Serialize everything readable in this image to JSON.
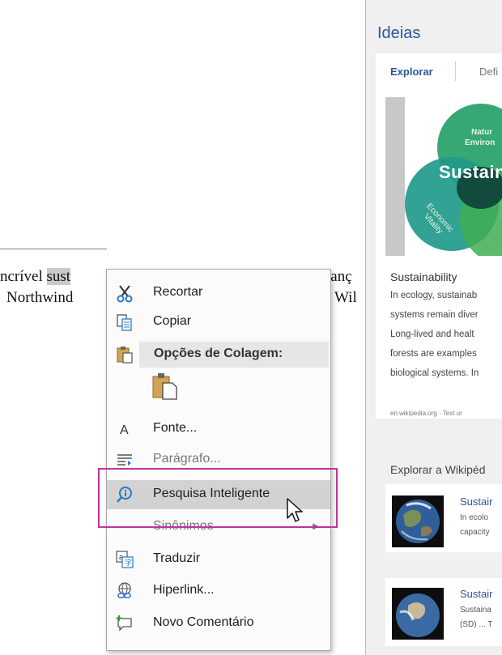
{
  "document": {
    "line1": {
      "prefix": "ncrível ",
      "highlight": "sust",
      "highlight2": "                ",
      "right": "lanç"
    },
    "line2": {
      "left": "Northwind",
      "right": "Wil"
    }
  },
  "ideas_pane": {
    "title": "Ideias",
    "tabs": [
      "Explorar",
      "Defi"
    ],
    "card": {
      "image_labels": {
        "top": "Natur",
        "top2": "Environ",
        "center": "Sustaina",
        "left": "Economic Vitality"
      },
      "heading": "Sustainability",
      "lines": [
        "In ecology, sustainab",
        "systems remain diver",
        "Long-lived and healt",
        "forests are examples",
        "biological systems. In"
      ],
      "source": "en.wikipedia.org · Text ur"
    },
    "section_title": "Explorar a Wikipéd",
    "results": [
      {
        "title": "Sustair",
        "line1": "In ecolo",
        "line2": "capacity"
      },
      {
        "title": "Sustair",
        "line1": "Sustaina",
        "line2": "(SD) ... T"
      }
    ]
  },
  "context_menu": {
    "items": [
      {
        "name": "cut",
        "label": "Recortar",
        "accel": "e"
      },
      {
        "name": "copy",
        "label": "Copiar",
        "accel": "a"
      },
      {
        "name": "paste-options",
        "label": "Opções de Colagem:"
      },
      {
        "name": "font",
        "label": "Fonte..."
      },
      {
        "name": "paragraph",
        "label": "Parágrafo..."
      },
      {
        "name": "smart-lookup",
        "label": "Pesquisa Inteligente"
      },
      {
        "name": "synonyms",
        "label": "Sinônimos"
      },
      {
        "name": "translate",
        "label": "Traduzir"
      },
      {
        "name": "hyperlink",
        "label": "Hiperlink..."
      },
      {
        "name": "new-comment",
        "label": "Novo Comentário"
      }
    ],
    "highlighted_item": "Pesquisa Inteligente"
  },
  "colors": {
    "accent": "#2b579a",
    "callout": "#c2319e",
    "menu_hover": "#d2d2d2",
    "text_highlight": "#c9c9c9"
  },
  "icons": [
    "scissors-icon",
    "copy-icon",
    "clipboard-icon",
    "paste-keep-format-icon",
    "font-icon",
    "paragraph-icon",
    "smart-lookup-icon",
    "translate-icon",
    "hyperlink-icon",
    "new-comment-icon",
    "mouse-pointer-icon"
  ]
}
